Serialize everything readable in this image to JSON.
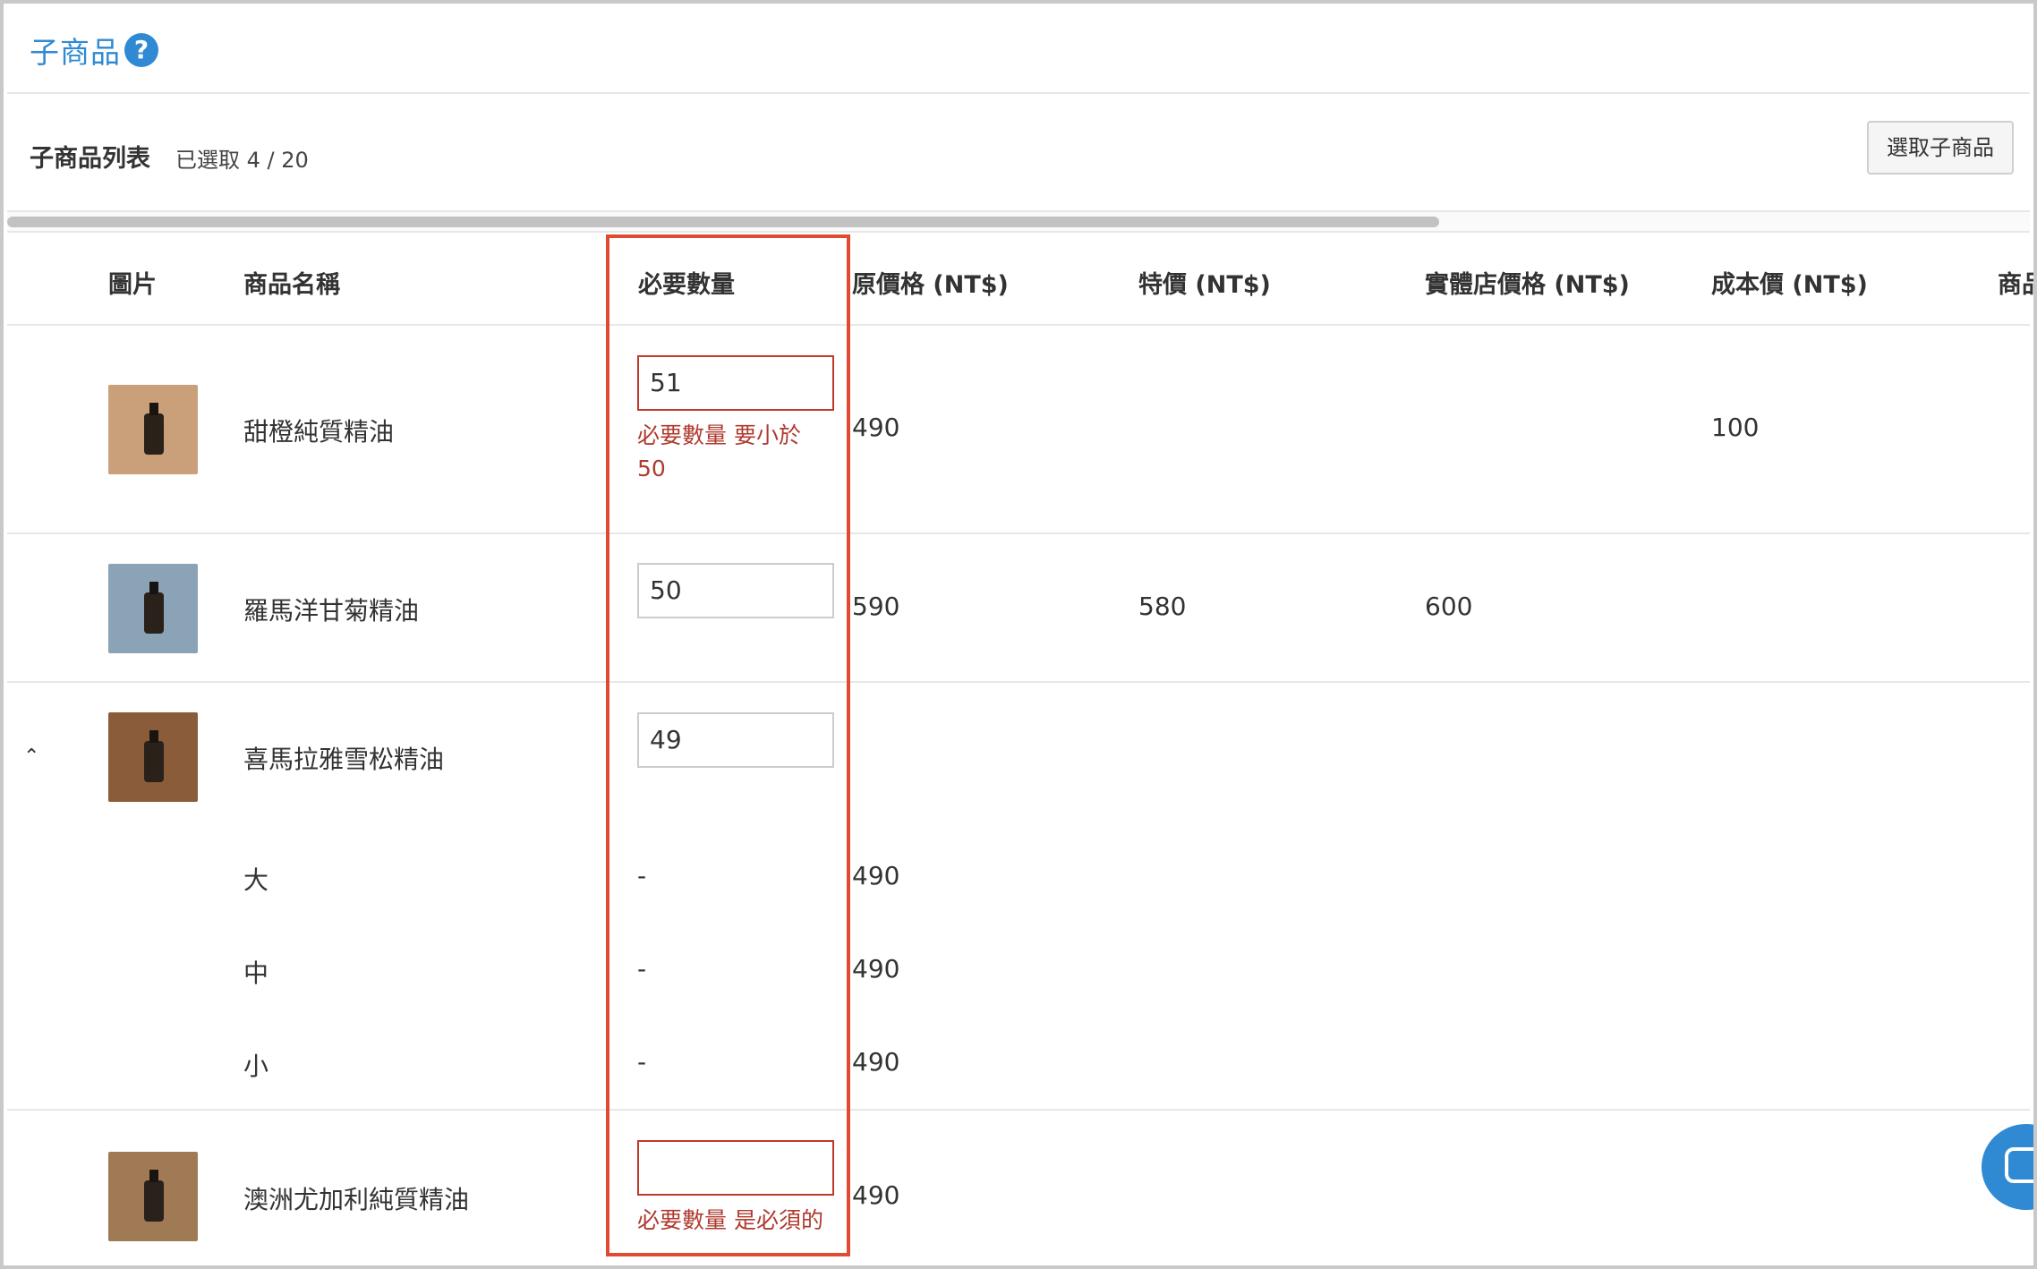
{
  "section": {
    "title": "子商品",
    "help_icon": "question-circle-icon"
  },
  "list": {
    "title": "子商品列表",
    "count": "已選取 4 / 20",
    "select_button": "選取子商品"
  },
  "columns": [
    "圖片",
    "商品名稱",
    "必要數量",
    "原價格 (NT$)",
    "特價 (NT$)",
    "實體店價格 (NT$)",
    "成本價 (NT$)",
    "商品"
  ],
  "rows": [
    {
      "name": "甜橙純質精油",
      "qty": "51",
      "error": "必要數量 要小於 50",
      "price": "490",
      "special": "",
      "store": "",
      "cost": "100",
      "thumb_color": "#c9a07a"
    },
    {
      "name": "羅馬洋甘菊精油",
      "qty": "50",
      "error": "",
      "price": "590",
      "special": "580",
      "store": "600",
      "cost": "",
      "thumb_color": "#8aa3b6"
    },
    {
      "name": "喜馬拉雅雪松精油",
      "qty": "49",
      "error": "",
      "price": "",
      "special": "",
      "store": "",
      "cost": "",
      "thumb_color": "#8a5c3a",
      "variants": [
        {
          "name": "大",
          "qty": "-",
          "price": "490"
        },
        {
          "name": "中",
          "qty": "-",
          "price": "490"
        },
        {
          "name": "小",
          "qty": "-",
          "price": "490"
        }
      ]
    },
    {
      "name": "澳洲尤加利純質精油",
      "qty": "",
      "error": "必要數量 是必須的",
      "price": "490",
      "special": "",
      "store": "",
      "cost": "",
      "thumb_color": "#a07a55"
    }
  ],
  "expand_icon": "chevron-up-icon",
  "chat_icon": "chat-icon",
  "colors": {
    "accent": "#2f8ad3",
    "error": "#b03a2e",
    "highlight": "#e04a33"
  }
}
